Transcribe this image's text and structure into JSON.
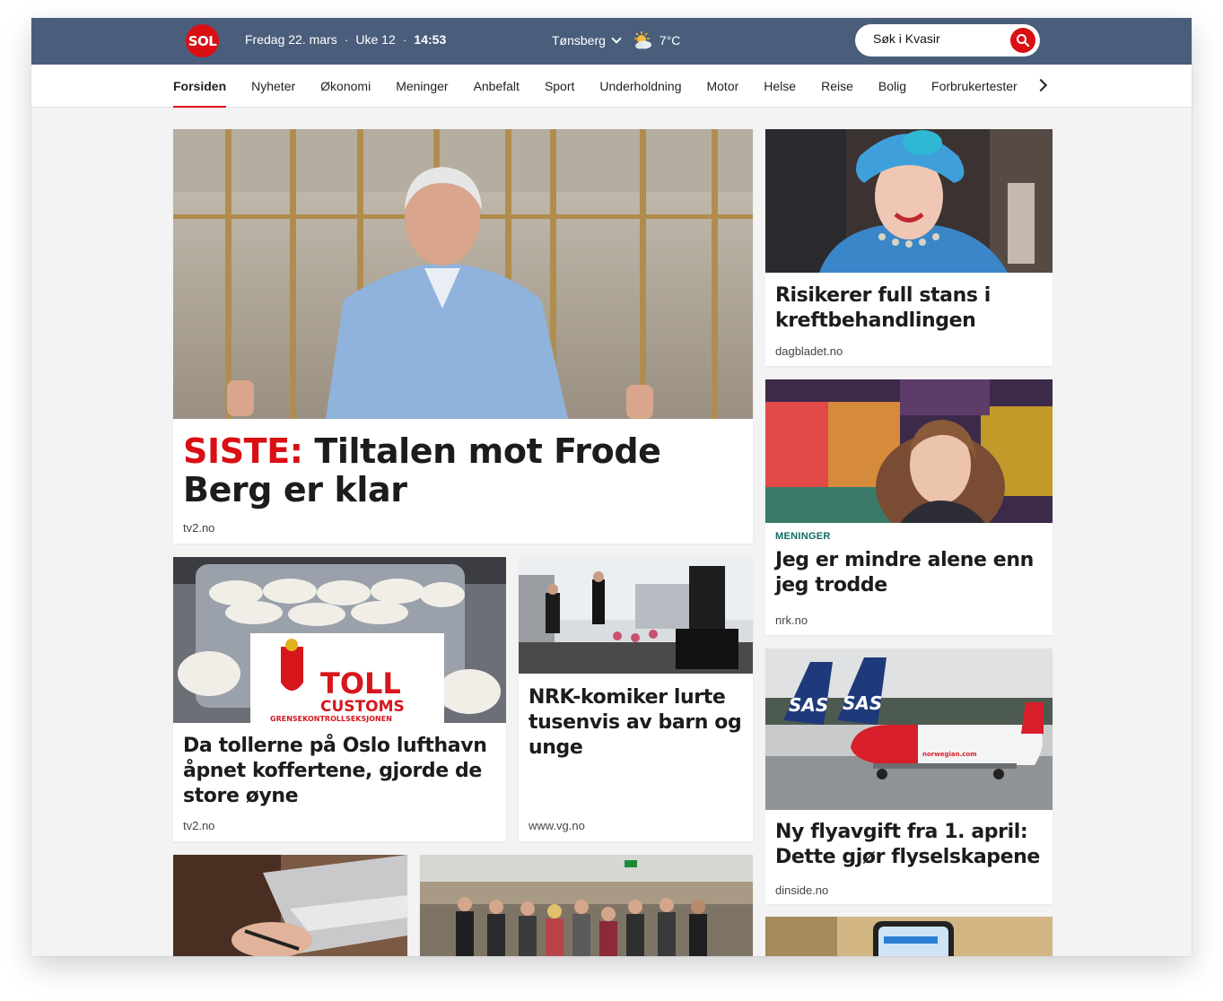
{
  "header": {
    "logo": "SOL",
    "date": "Fredag 22. mars",
    "week": "Uke 12",
    "time": "14:53",
    "location": "Tønsberg",
    "temperature": "7°C",
    "weather_icon": "partly-sunny-icon",
    "search_placeholder": "Søk i Kvasir",
    "brand_color": "#d90f14",
    "bar_color": "#4a5e7b"
  },
  "nav": {
    "items": [
      "Forsiden",
      "Nyheter",
      "Økonomi",
      "Meninger",
      "Anbefalt",
      "Sport",
      "Underholdning",
      "Motor",
      "Helse",
      "Reise",
      "Bolig",
      "Forbrukertester"
    ],
    "active": "Forsiden"
  },
  "articles": {
    "main": {
      "prefix": "SISTE:",
      "title": "Tiltalen mot Frode Berg er klar",
      "source": "tv2.no"
    },
    "toll": {
      "title": "Da tollerne på Oslo lufthavn åpnet koffertene, gjorde de store øyne",
      "source": "tv2.no",
      "image_text_1": "TOLL",
      "image_text_2": "CUSTOMS",
      "image_text_3": "GRENSEKONTROLLSEKSJONEN"
    },
    "nrk": {
      "title": "NRK-komiker lurte tusenvis av barn og unge",
      "source": "www.vg.no"
    },
    "kreft": {
      "title": "Risikerer full stans i kreftbehandlingen",
      "source": "dagbladet.no"
    },
    "alene": {
      "kicker": "MENINGER",
      "title": "Jeg er mindre alene enn jeg trodde",
      "source": "nrk.no"
    },
    "fly": {
      "title": "Ny flyavgift fra 1. april: Dette gjør flyselskapene",
      "source": "dinside.no",
      "image_text_1": "SAS",
      "image_text_2": "SAS",
      "image_text_3": "norwegian.com"
    }
  }
}
